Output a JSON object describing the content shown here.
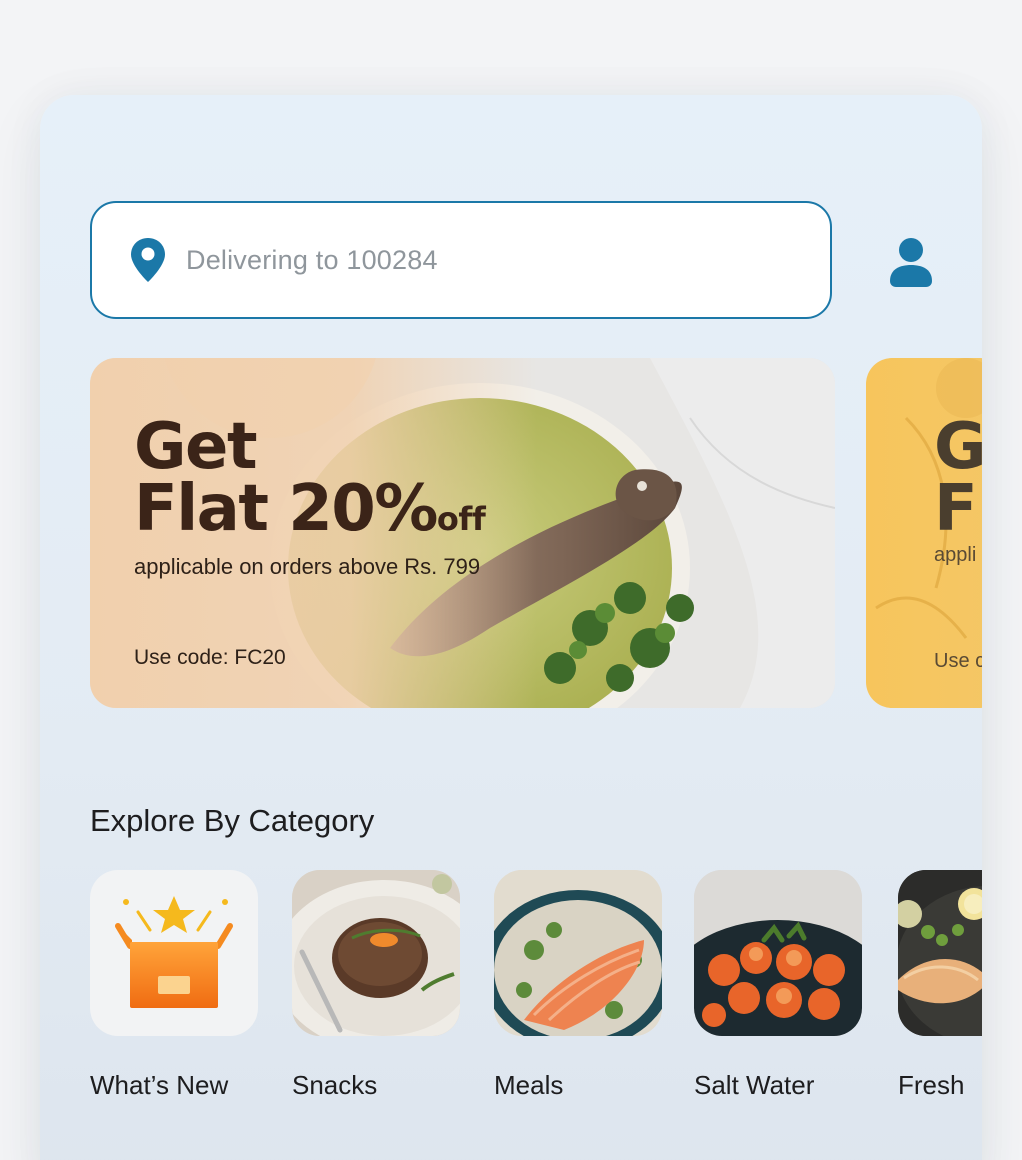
{
  "location": {
    "text": "Delivering to 100284",
    "icon": "map-pin-icon"
  },
  "profile": {
    "icon": "user-icon"
  },
  "banners": [
    {
      "line1": "Get",
      "line2": "Flat 20%",
      "off": "off",
      "subtitle": "applicable on orders above Rs. 799",
      "code": "Use code: FC20"
    },
    {
      "line1": "G",
      "line2": "Fl",
      "subtitle": "appli",
      "code": "Use c"
    }
  ],
  "categories": {
    "title": "Explore By Category",
    "items": [
      {
        "label": "What’s New",
        "icon": "gift-box-icon"
      },
      {
        "label": "Snacks",
        "icon": "steak-plate-image"
      },
      {
        "label": "Meals",
        "icon": "salmon-bowl-image"
      },
      {
        "label": "Salt Water",
        "icon": "shrimp-dish-image"
      },
      {
        "label": "Fresh",
        "icon": "fish-pan-image"
      }
    ]
  },
  "colors": {
    "accent": "#1b78a8",
    "background": "#e4edf6",
    "banner_text": "#3b2418",
    "gift_orange": "#f58a1f",
    "star_yellow": "#f5b91d"
  }
}
